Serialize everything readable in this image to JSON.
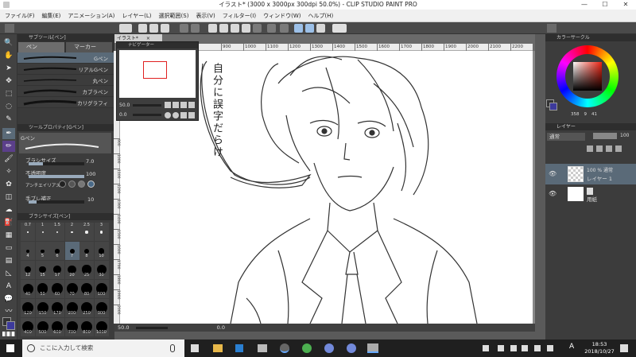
{
  "window": {
    "title": "イラスト* (3000 x 3000px 300dpi 50.0%) - CLIP STUDIO PAINT PRO",
    "minimize": "—",
    "maximize": "☐",
    "close": "✕"
  },
  "menu": [
    "ファイル(F)",
    "編集(E)",
    "アニメーション(A)",
    "レイヤー(L)",
    "選択範囲(S)",
    "表示(V)",
    "フィルター(I)",
    "ウィンドウ(W)",
    "ヘルプ(H)"
  ],
  "subtool_panel": {
    "header": "サブツール[ペン]",
    "tabs": [
      "ペン",
      "マーカー"
    ],
    "brushes": [
      "Gペン",
      "リアルGペン",
      "丸ペン",
      "カブラペン",
      "カリグラフィ"
    ]
  },
  "tool_property": {
    "header": "ツールプロパティ[Gペン]",
    "name": "Gペン",
    "brush_size_label": "ブラシサイズ",
    "brush_size_value": "7.0",
    "opacity_label": "不透明度",
    "opacity_value": "100",
    "antialias_label": "アンチエイリアス",
    "stabilization_label": "手ブレ補正",
    "stabilization_value": "10"
  },
  "brush_size_panel": {
    "header": "ブラシサイズ[ペン]",
    "sizes": [
      "0.7",
      "1",
      "1.5",
      "2",
      "2.5",
      "3",
      "4",
      "5",
      "6",
      "7",
      "8",
      "10",
      "12",
      "15",
      "17",
      "20",
      "25",
      "30",
      "40",
      "50",
      "60",
      "70",
      "80",
      "100",
      "120",
      "150",
      "170",
      "200",
      "250",
      "300",
      "400",
      "500",
      "600",
      "700",
      "800",
      "1000"
    ]
  },
  "canvas": {
    "tab_label": "イラスト*",
    "zoom": "50.0",
    "angle": "0.0",
    "ruler_marks": [
      "900",
      "1000",
      "1100",
      "1200",
      "1300",
      "1400",
      "1500",
      "1600",
      "1700",
      "1800",
      "1900",
      "2000",
      "2100",
      "2200"
    ],
    "ruler_left_marks": [
      "900",
      "1000",
      "1100",
      "1200",
      "1300",
      "1400",
      "1500",
      "1600",
      "1700",
      "1800",
      "1900",
      "2000"
    ],
    "speech_text": "自分に誤字だらけ"
  },
  "navigator": {
    "header": "ナビゲーター",
    "zoom": "50.0",
    "angle": "0.0"
  },
  "right_panel": {
    "color_header": "カラーサークル",
    "hsv_values": [
      "358",
      "9",
      "41"
    ],
    "layer_header": "レイヤー",
    "blend_mode": "通常",
    "opacity": "100",
    "layers": [
      {
        "name": "レイヤー 1",
        "info": "100 % 通常"
      },
      {
        "name": "用紙",
        "info": ""
      }
    ]
  },
  "taskbar": {
    "search_placeholder": "ここに入力して検索",
    "time": "18:53",
    "date": "2018/10/27",
    "ime": "A"
  }
}
